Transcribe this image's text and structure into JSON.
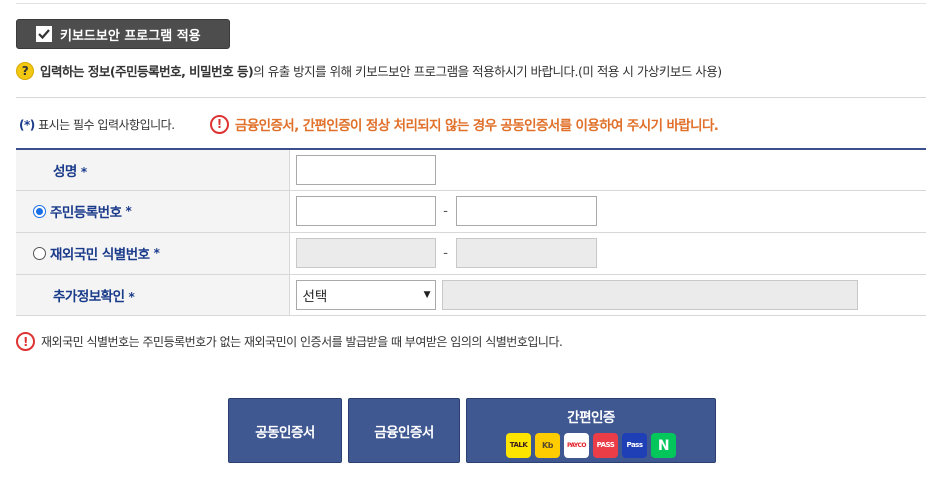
{
  "keyboard_security": {
    "label": "키보드보안 프로그램 적용",
    "checked": true
  },
  "notice": {
    "bold_text": "입력하는 정보(주민등록번호, 비밀번호 등)",
    "rest_text": "의 유출 방지를 위해 키보드보안 프로그램을 적용하시기 바랍니다.(미 적용 시 가상키보드 사용)"
  },
  "required_note": {
    "star": "(*)",
    "text": "표시는 필수 입력사항입니다."
  },
  "warning": "금융인증서, 간편인증이 정상 처리되지 않는 경우 공동인증서를 이용하여 주시기 바랍니다.",
  "form": {
    "name_label": "성명",
    "rrn_label": "주민등록번호",
    "foreign_label": "재외국민 식별번호",
    "extra_label": "추가정보확인",
    "required_mark": "*",
    "dash": "-",
    "select_value": "선택",
    "selected_radio": "rrn"
  },
  "bottom_note": "재외국민 식별번호는 주민등록번호가 없는 재외국민이 인증서를 발급받을 때 부여받은 임의의 식별번호입니다.",
  "buttons": {
    "joint_cert": "공동인증서",
    "financial_cert": "금융인증서",
    "simple_auth": "간편인증",
    "simple_icons": [
      {
        "name": "kakaotalk-icon",
        "text": "TALK"
      },
      {
        "name": "kb-icon",
        "text": "Kb"
      },
      {
        "name": "payco-icon",
        "text": "PAYCO"
      },
      {
        "name": "pass-icon",
        "text": "PASS"
      },
      {
        "name": "samsung-pass-icon",
        "text": "Pass"
      },
      {
        "name": "naver-icon",
        "text": "N"
      }
    ]
  }
}
